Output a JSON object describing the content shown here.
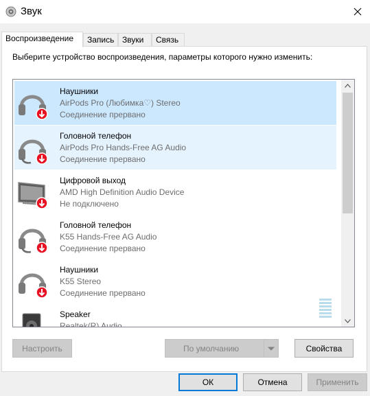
{
  "window": {
    "title": "Звук"
  },
  "tabs": [
    {
      "label": "Воспроизведение",
      "active": true
    },
    {
      "label": "Запись",
      "active": false
    },
    {
      "label": "Звуки",
      "active": false
    },
    {
      "label": "Связь",
      "active": false
    }
  ],
  "instruction": "Выберите устройство воспроизведения, параметры которого нужно изменить:",
  "devices": [
    {
      "name": "Наушники",
      "description": "AirPods Pro (Любимка♡) Stereo",
      "status": "Соединение прервано",
      "icon": "headphones-icon",
      "state": "selected"
    },
    {
      "name": "Головной телефон",
      "description": "AirPods Pro Hands-Free AG Audio",
      "status": "Соединение прервано",
      "icon": "headset-icon",
      "state": "hover"
    },
    {
      "name": "Цифровой выход",
      "description": "AMD High Definition Audio Device",
      "status": "Не подключено",
      "icon": "monitor-icon",
      "state": "normal"
    },
    {
      "name": "Головной телефон",
      "description": "K55 Hands-Free AG Audio",
      "status": "Соединение прервано",
      "icon": "headset-icon",
      "state": "normal"
    },
    {
      "name": "Наушники",
      "description": "K55 Stereo",
      "status": "Соединение прервано",
      "icon": "headphones-icon",
      "state": "normal"
    },
    {
      "name": "Speaker",
      "description": "Realtek(R) Audio",
      "status": "",
      "icon": "speaker-icon",
      "state": "normal"
    }
  ],
  "buttons": {
    "configure": "Настроить",
    "set_default": "По умолчанию",
    "properties": "Свойства",
    "ok": "ОК",
    "cancel": "Отмена",
    "apply": "Применить"
  },
  "colors": {
    "selected_row": "#cce8ff",
    "hover_row": "#e5f3ff",
    "default_button_border": "#0078d7",
    "status_red": "#e81123"
  }
}
